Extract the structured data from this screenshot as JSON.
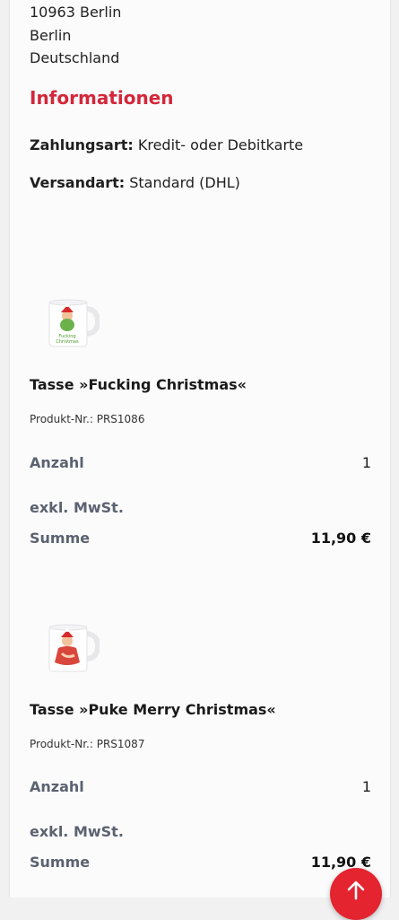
{
  "address": {
    "line1": "10963 Berlin",
    "line2": "Berlin",
    "line3": "Deutschland"
  },
  "informationen": {
    "title": "Informationen",
    "payment_label": "Zahlungsart:",
    "payment_value": "Kredit- oder Debitkarte",
    "shipping_label": "Versandart:",
    "shipping_value": "Standard (DHL)"
  },
  "products": [
    {
      "name": "Tasse »Fucking Christmas«",
      "sku": "Produkt-Nr.: PRS1086",
      "quantity_label": "Anzahl",
      "quantity": "1",
      "tax_label": "exkl. MwSt.",
      "sum_label": "Summe",
      "sum": "11,90 €",
      "image_icon": "mug-icon"
    },
    {
      "name": "Tasse »Puke Merry Christmas«",
      "sku": "Produkt-Nr.: PRS1087",
      "quantity_label": "Anzahl",
      "quantity": "1",
      "tax_label": "exkl. MwSt.",
      "sum_label": "Summe",
      "sum": "11,90 €",
      "image_icon": "mug-icon"
    }
  ],
  "scroll_top_button": {
    "icon": "arrow-up-icon"
  },
  "colors": {
    "accent": "#d3273a",
    "fab": "#e4242f",
    "label": "#5b6270"
  }
}
